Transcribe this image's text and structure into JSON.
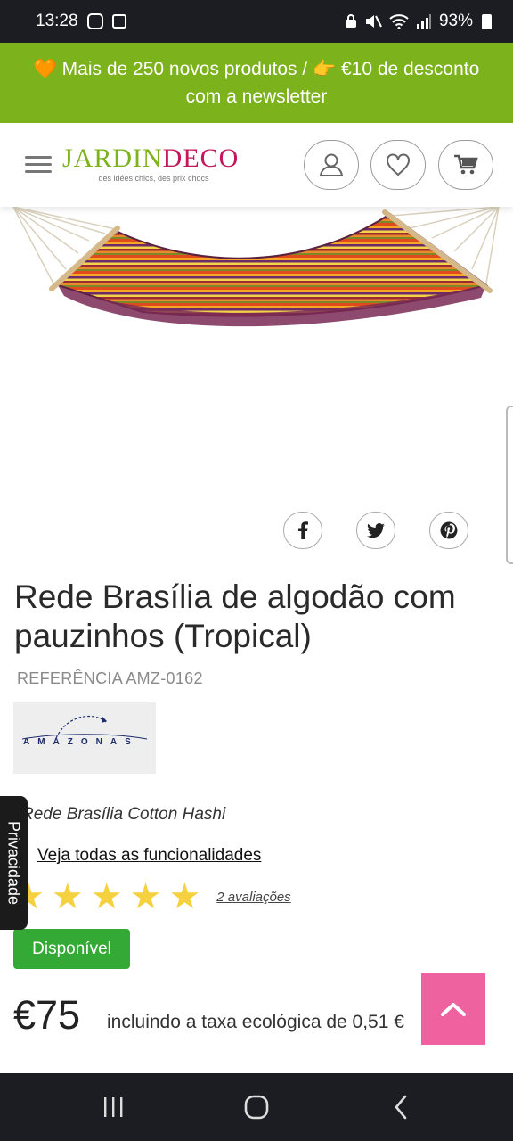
{
  "status_bar": {
    "time": "13:28",
    "battery": "93%"
  },
  "promo": {
    "text_line1": "🧡 Mais de 250 novos produtos / 👉 €10 de desconto",
    "text_line2": "com a newsletter"
  },
  "header": {
    "logo_part1": "JARDIN",
    "logo_part2": "DECO",
    "logo_tagline": "des idées chics, des prix chocs"
  },
  "product": {
    "title": "Rede Brasília de algodão com pauzinhos (Tropical)",
    "reference": "REFERÊNCIA AMZ-0162",
    "brand": "AMAZONAS",
    "subtitle": "Rede Brasília Cotton Hashi",
    "features_link": "Veja todas as funcionalidades",
    "rating": 5,
    "stars": [
      "★",
      "★",
      "★",
      "★",
      "★"
    ],
    "reviews": "2 avaliações",
    "availability": "Disponível",
    "price": "€75",
    "price_note": "incluindo a taxa ecológica de 0,51 €"
  },
  "privacy_tab": "Privacidade",
  "colors": {
    "promo_green": "#7cb21b",
    "logo_green": "#7cb21b",
    "logo_pink": "#c2185b",
    "available_green": "#35a936",
    "back_to_top_pink": "#ee5a9a",
    "star_yellow": "#f5d13f"
  },
  "icons": {
    "header": [
      "menu-icon",
      "account-icon",
      "heart-icon",
      "cart-icon"
    ],
    "share": [
      "facebook-icon",
      "twitter-icon",
      "pinterest-icon"
    ],
    "nav": [
      "recents-icon",
      "home-icon",
      "back-icon"
    ],
    "back_to_top": "chevron-up-icon"
  }
}
